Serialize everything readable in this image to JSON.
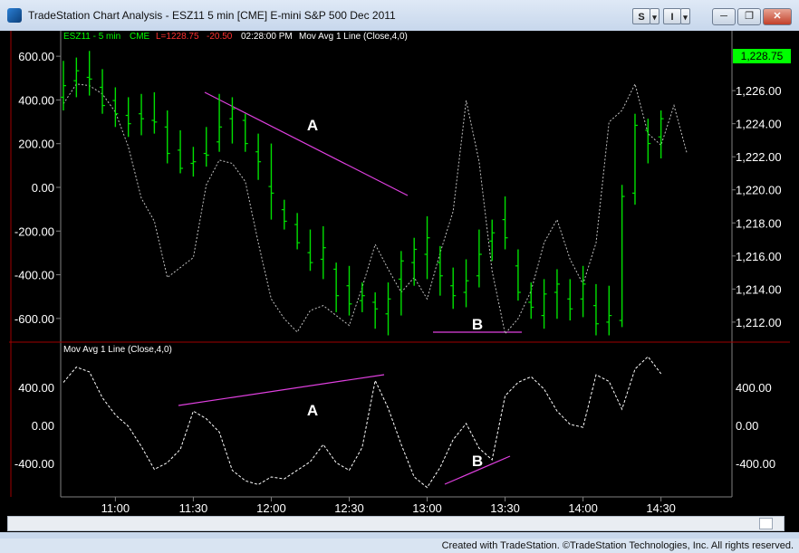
{
  "window": {
    "title": "TradeStation Chart Analysis - ESZ11 5 min [CME] E-mini S&P 500 Dec 2011",
    "s_button": "S",
    "i_button": "I",
    "dropdown_glyph": "▾",
    "minimize_glyph": "─",
    "restore_glyph": "❐",
    "close_glyph": "✕"
  },
  "chart_header": {
    "symbol": "ESZ11 - 5 min",
    "exchange": "CME",
    "last": "L=1228.75",
    "change": "-20.50",
    "time": "02:28:00 PM",
    "indicator": "Mov Avg 1 Line (Close,4,0)"
  },
  "lower_header": {
    "indicator": "Mov Avg 1 Line (Close,4,0)"
  },
  "price_label": "1,228.75",
  "annotations": {
    "upper_a": "A",
    "upper_b": "B",
    "lower_a": "A",
    "lower_b": "B"
  },
  "status": {
    "text": "Created with TradeStation. ©TradeStation Technologies, Inc. All rights reserved."
  },
  "colors": {
    "bars": "#00e000",
    "ma": "#c0c0c0",
    "annotation": "#e040e0",
    "divider": "#c00000",
    "header_green": "#00ff00",
    "header_red": "#ff3030"
  },
  "chart_data": [
    {
      "type": "bar",
      "title": "ESZ11 5 min - price bars with Mov Avg 1 Line (Close,4,0)",
      "x_tick_labels": [
        "11:00",
        "11:30",
        "12:00",
        "12:30",
        "13:00",
        "13:30",
        "14:00",
        "14:30"
      ],
      "x_range": [
        "10:40",
        "14:35"
      ],
      "left_axis": {
        "ticks": [
          "600.00",
          "400.00",
          "200.00",
          "0.00",
          "-200.00",
          "-400.00",
          "-600.00"
        ],
        "range": [
          -700,
          700
        ]
      },
      "right_axis": {
        "ticks": [
          "1,226.00",
          "1,224.00",
          "1,222.00",
          "1,220.00",
          "1,218.00",
          "1,216.00",
          "1,214.00",
          "1,212.00"
        ],
        "range": [
          1210.9,
          1229.4
        ]
      },
      "ohlc": [
        [
          "10:40",
          1225.6,
          1227.8,
          1224.8,
          1226.3
        ],
        [
          "10:45",
          1226.6,
          1228.0,
          1225.6,
          1227.2
        ],
        [
          "10:50",
          1226.8,
          1228.4,
          1225.7,
          1226.7
        ],
        [
          "10:55",
          1226.2,
          1227.3,
          1224.6,
          1225.1
        ],
        [
          "11:00",
          1225.4,
          1226.2,
          1223.8,
          1224.6
        ],
        [
          "11:05",
          1224.5,
          1225.6,
          1223.2,
          1224.0
        ],
        [
          "11:10",
          1224.6,
          1225.8,
          1223.3,
          1224.3
        ],
        [
          "11:15",
          1224.2,
          1225.9,
          1223.4,
          1224.1
        ],
        [
          "11:20",
          1223.8,
          1224.8,
          1221.6,
          1222.2
        ],
        [
          "11:25",
          1222.4,
          1223.6,
          1221.0,
          1221.3
        ],
        [
          "11:30",
          1221.6,
          1222.6,
          1220.8,
          1221.7
        ],
        [
          "11:35",
          1222.2,
          1223.8,
          1221.4,
          1222.1
        ],
        [
          "11:40",
          1222.9,
          1225.8,
          1222.3,
          1223.8
        ],
        [
          "11:45",
          1224.3,
          1225.6,
          1222.8,
          1224.9
        ],
        [
          "11:50",
          1224.2,
          1224.6,
          1222.3,
          1222.8
        ],
        [
          "11:55",
          1222.3,
          1223.4,
          1220.6,
          1221.7
        ],
        [
          "12:00",
          1220.2,
          1222.8,
          1218.2,
          1219.8
        ],
        [
          "12:05",
          1218.8,
          1219.4,
          1217.6,
          1218.1
        ],
        [
          "12:10",
          1217.9,
          1218.6,
          1216.4,
          1216.8
        ],
        [
          "12:15",
          1216.2,
          1217.6,
          1215.1,
          1215.6
        ],
        [
          "12:20",
          1215.8,
          1217.8,
          1214.6,
          1216.5
        ],
        [
          "12:25",
          1215.2,
          1215.6,
          1212.6,
          1213.6
        ],
        [
          "12:30",
          1214.2,
          1215.4,
          1212.4,
          1213.1
        ],
        [
          "12:35",
          1213.3,
          1214.4,
          1212.6,
          1213.6
        ],
        [
          "12:40",
          1213.2,
          1213.8,
          1211.6,
          1212.8
        ],
        [
          "12:45",
          1212.5,
          1214.4,
          1211.2,
          1213.4
        ],
        [
          "12:50",
          1214.6,
          1216.3,
          1212.4,
          1215.7
        ],
        [
          "12:55",
          1215.6,
          1217.1,
          1214.2,
          1216.4
        ],
        [
          "13:00",
          1216.1,
          1218.4,
          1214.6,
          1217.1
        ],
        [
          "13:05",
          1215.6,
          1216.6,
          1213.6,
          1214.8
        ],
        [
          "13:10",
          1214.2,
          1215.3,
          1212.8,
          1213.6
        ],
        [
          "13:15",
          1213.8,
          1215.8,
          1212.9,
          1214.5
        ],
        [
          "13:20",
          1214.8,
          1217.6,
          1214.1,
          1216.1
        ],
        [
          "13:25",
          1216.9,
          1218.2,
          1215.7,
          1217.4
        ],
        [
          "13:30",
          1218.2,
          1219.6,
          1216.4,
          1217.1
        ],
        [
          "13:35",
          1215.4,
          1216.4,
          1213.3,
          1213.8
        ],
        [
          "13:40",
          1213.2,
          1214.4,
          1212.2,
          1212.9
        ],
        [
          "13:45",
          1212.4,
          1214.6,
          1211.6,
          1213.7
        ],
        [
          "13:50",
          1213.8,
          1215.2,
          1212.2,
          1214.3
        ],
        [
          "13:55",
          1213.4,
          1214.6,
          1212.1,
          1212.8
        ],
        [
          "14:00",
          1213.4,
          1215.4,
          1212.3,
          1214.3
        ],
        [
          "14:05",
          1213.0,
          1214.3,
          1211.2,
          1211.9
        ],
        [
          "14:10",
          1212.0,
          1214.2,
          1211.2,
          1212.4
        ],
        [
          "14:15",
          1212.1,
          1220.3,
          1211.7,
          1219.6
        ],
        [
          "14:20",
          1219.8,
          1224.6,
          1219.1,
          1223.9
        ],
        [
          "14:25",
          1223.6,
          1224.3,
          1221.6,
          1222.8
        ],
        [
          "14:30",
          1223.2,
          1224.8,
          1221.9,
          1224.3
        ]
      ],
      "moving_average_line": [
        [
          "10:40",
          1225.2
        ],
        [
          "10:45",
          1226.4
        ],
        [
          "10:50",
          1226.3
        ],
        [
          "10:55",
          1225.8
        ],
        [
          "11:00",
          1224.7
        ],
        [
          "11:05",
          1222.6
        ],
        [
          "11:10",
          1219.5
        ],
        [
          "11:15",
          1218.1
        ],
        [
          "11:20",
          1214.7
        ],
        [
          "11:25",
          1215.3
        ],
        [
          "11:30",
          1215.9
        ],
        [
          "11:35",
          1220.3
        ],
        [
          "11:40",
          1221.8
        ],
        [
          "11:45",
          1221.6
        ],
        [
          "11:50",
          1220.5
        ],
        [
          "11:55",
          1216.8
        ],
        [
          "12:00",
          1213.4
        ],
        [
          "12:05",
          1212.2
        ],
        [
          "12:10",
          1211.4
        ],
        [
          "12:15",
          1212.7
        ],
        [
          "12:20",
          1213.0
        ],
        [
          "12:25",
          1212.4
        ],
        [
          "12:30",
          1211.8
        ],
        [
          "12:35",
          1214.1
        ],
        [
          "12:40",
          1216.7
        ],
        [
          "12:45",
          1215.2
        ],
        [
          "12:50",
          1213.8
        ],
        [
          "12:55",
          1214.7
        ],
        [
          "13:00",
          1213.4
        ],
        [
          "13:05",
          1216.2
        ],
        [
          "13:10",
          1218.7
        ],
        [
          "13:15",
          1225.4
        ],
        [
          "13:20",
          1221.7
        ],
        [
          "13:25",
          1215.1
        ],
        [
          "13:30",
          1211.3
        ],
        [
          "13:35",
          1212.2
        ],
        [
          "13:40",
          1213.9
        ],
        [
          "13:45",
          1216.8
        ],
        [
          "13:50",
          1218.2
        ],
        [
          "13:55",
          1215.8
        ],
        [
          "14:00",
          1214.3
        ],
        [
          "14:05",
          1216.8
        ],
        [
          "14:10",
          1224.1
        ],
        [
          "14:15",
          1224.8
        ],
        [
          "14:20",
          1226.4
        ],
        [
          "14:25",
          1223.4
        ],
        [
          "14:30",
          1222.7
        ],
        [
          "14:35",
          1225.1
        ],
        [
          "14:40",
          1222.2
        ]
      ],
      "annotation_labels": [
        "A",
        "B"
      ]
    },
    {
      "type": "line",
      "title": "Mov Avg 1 Line (Close,4,0)",
      "y_tick_labels": [
        "400.00",
        "0.00",
        "-400.00"
      ],
      "ylim": [
        -720,
        720
      ],
      "series": [
        {
          "name": "Mov Avg 1 Line (Close,4,0)",
          "points": [
            [
              "10:40",
              450
            ],
            [
              "10:45",
              610
            ],
            [
              "10:50",
              560
            ],
            [
              "10:55",
              290
            ],
            [
              "11:00",
              110
            ],
            [
              "11:05",
              -10
            ],
            [
              "11:10",
              -220
            ],
            [
              "11:15",
              -460
            ],
            [
              "11:20",
              -390
            ],
            [
              "11:25",
              -250
            ],
            [
              "11:30",
              150
            ],
            [
              "11:35",
              70
            ],
            [
              "11:40",
              -70
            ],
            [
              "11:45",
              -470
            ],
            [
              "11:50",
              -580
            ],
            [
              "11:55",
              -620
            ],
            [
              "12:00",
              -540
            ],
            [
              "12:05",
              -560
            ],
            [
              "12:10",
              -470
            ],
            [
              "12:15",
              -380
            ],
            [
              "12:20",
              -200
            ],
            [
              "12:25",
              -390
            ],
            [
              "12:30",
              -470
            ],
            [
              "12:35",
              -230
            ],
            [
              "12:40",
              470
            ],
            [
              "12:45",
              180
            ],
            [
              "12:50",
              -200
            ],
            [
              "12:55",
              -540
            ],
            [
              "13:00",
              -650
            ],
            [
              "13:05",
              -440
            ],
            [
              "13:10",
              -150
            ],
            [
              "13:15",
              20
            ],
            [
              "13:20",
              -240
            ],
            [
              "13:25",
              -360
            ],
            [
              "13:30",
              310
            ],
            [
              "13:35",
              450
            ],
            [
              "13:40",
              510
            ],
            [
              "13:45",
              380
            ],
            [
              "13:50",
              150
            ],
            [
              "13:55",
              10
            ],
            [
              "14:00",
              -20
            ],
            [
              "14:05",
              530
            ],
            [
              "14:10",
              460
            ],
            [
              "14:15",
              170
            ],
            [
              "14:20",
              590
            ],
            [
              "14:25",
              720
            ],
            [
              "14:30",
              540
            ]
          ]
        }
      ],
      "annotation_labels": [
        "A",
        "B"
      ]
    }
  ]
}
